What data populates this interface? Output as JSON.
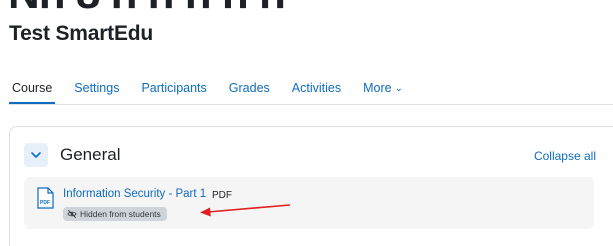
{
  "course": {
    "title": "Test SmartEdu"
  },
  "nav": {
    "items": [
      {
        "label": "Course",
        "active": true
      },
      {
        "label": "Settings"
      },
      {
        "label": "Participants"
      },
      {
        "label": "Grades"
      },
      {
        "label": "Activities"
      },
      {
        "label": "More"
      }
    ]
  },
  "section": {
    "title": "General",
    "collapse_all": "Collapse all"
  },
  "activity": {
    "name": "Information Security - Part 1",
    "type": "PDF",
    "badge": "Hidden from students",
    "icon_label": "PDF"
  },
  "colors": {
    "link": "#0f6cbf",
    "annotation_arrow": "#e02020",
    "badge_bg": "#ced4da"
  }
}
